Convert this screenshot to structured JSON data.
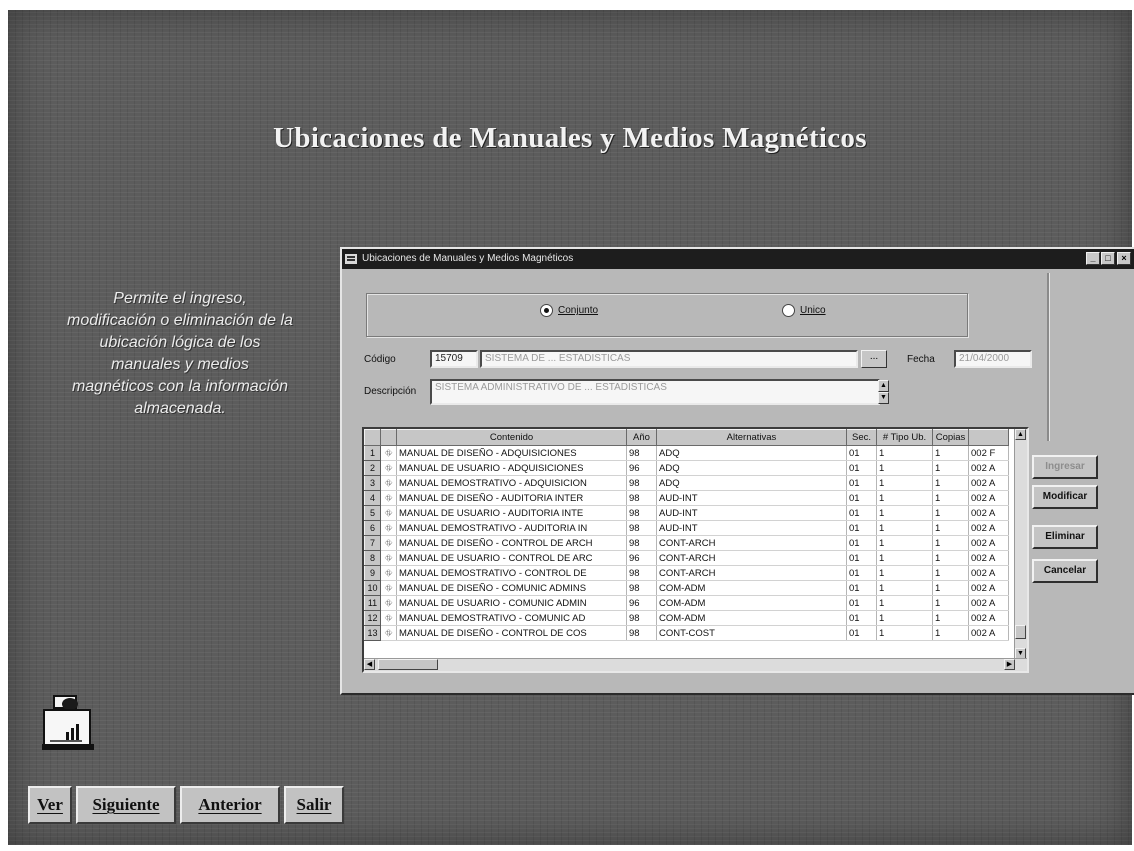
{
  "slide": {
    "title": "Ubicaciones de Manuales y Medios Magnéticos",
    "description": [
      "Permite el ingreso,",
      "modificación o eliminación de la",
      "ubicación lógica de los",
      "manuales y medios",
      "magnéticos con la información",
      "almacenada."
    ]
  },
  "nav": {
    "ver": "Ver",
    "siguiente": "Siguiente",
    "anterior": "Anterior",
    "salir": "Salir"
  },
  "window": {
    "title": "Ubicaciones de Manuales y Medios Magnéticos",
    "radio_options": [
      {
        "label": "Conjunto",
        "selected": true
      },
      {
        "label": "Unico",
        "selected": false
      }
    ],
    "form": {
      "codigo_label": "Código",
      "codigo_value": "15709",
      "codigo_name": "SISTEMA DE ... ESTADISTICAS",
      "browse_label": "...",
      "fecha_label": "Fecha",
      "fecha_value": "21/04/2000",
      "descripcion_label": "Descripción",
      "descripcion_value": "SISTEMA ADMINISTRATIVO DE ... ESTADISTICAS"
    },
    "buttons": {
      "ingresar": "Ingresar",
      "modificar": "Modificar",
      "eliminar": "Eliminar",
      "cancelar": "Cancelar"
    },
    "grid": {
      "columns": [
        "Contenido",
        "Año",
        "Alternativas",
        "Sec.",
        "# Tipo Ub.",
        "Copias",
        ""
      ],
      "rows": [
        [
          "1",
          "MANUAL DE DISEÑO - ADQUISICIONES",
          "98",
          "ADQ",
          "01",
          "1",
          "1",
          "002 F"
        ],
        [
          "2",
          "MANUAL DE USUARIO - ADQUISICIONES",
          "96",
          "ADQ",
          "01",
          "1",
          "1",
          "002 A"
        ],
        [
          "3",
          "MANUAL DEMOSTRATIVO - ADQUISICION",
          "98",
          "ADQ",
          "01",
          "1",
          "1",
          "002 A"
        ],
        [
          "4",
          "MANUAL DE DISEÑO - AUDITORIA INTER",
          "98",
          "AUD-INT",
          "01",
          "1",
          "1",
          "002 A"
        ],
        [
          "5",
          "MANUAL DE USUARIO - AUDITORIA INTE",
          "98",
          "AUD-INT",
          "01",
          "1",
          "1",
          "002 A"
        ],
        [
          "6",
          "MANUAL DEMOSTRATIVO - AUDITORIA IN",
          "98",
          "AUD-INT",
          "01",
          "1",
          "1",
          "002 A"
        ],
        [
          "7",
          "MANUAL DE DISEÑO - CONTROL DE ARCH",
          "98",
          "CONT-ARCH",
          "01",
          "1",
          "1",
          "002 A"
        ],
        [
          "8",
          "MANUAL DE USUARIO - CONTROL DE ARC",
          "96",
          "CONT-ARCH",
          "01",
          "1",
          "1",
          "002 A"
        ],
        [
          "9",
          "MANUAL DEMOSTRATIVO - CONTROL DE",
          "98",
          "CONT-ARCH",
          "01",
          "1",
          "1",
          "002 A"
        ],
        [
          "10",
          "MANUAL DE DISEÑO - COMUNIC ADMINS",
          "98",
          "COM-ADM",
          "01",
          "1",
          "1",
          "002 A"
        ],
        [
          "11",
          "MANUAL DE USUARIO - COMUNIC ADMIN",
          "96",
          "COM-ADM",
          "01",
          "1",
          "1",
          "002 A"
        ],
        [
          "12",
          "MANUAL DEMOSTRATIVO - COMUNIC AD",
          "98",
          "COM-ADM",
          "01",
          "1",
          "1",
          "002 A"
        ],
        [
          "13",
          "MANUAL DE DISEÑO - CONTROL DE COS",
          "98",
          "CONT-COST",
          "01",
          "1",
          "1",
          "002 A"
        ]
      ]
    }
  }
}
